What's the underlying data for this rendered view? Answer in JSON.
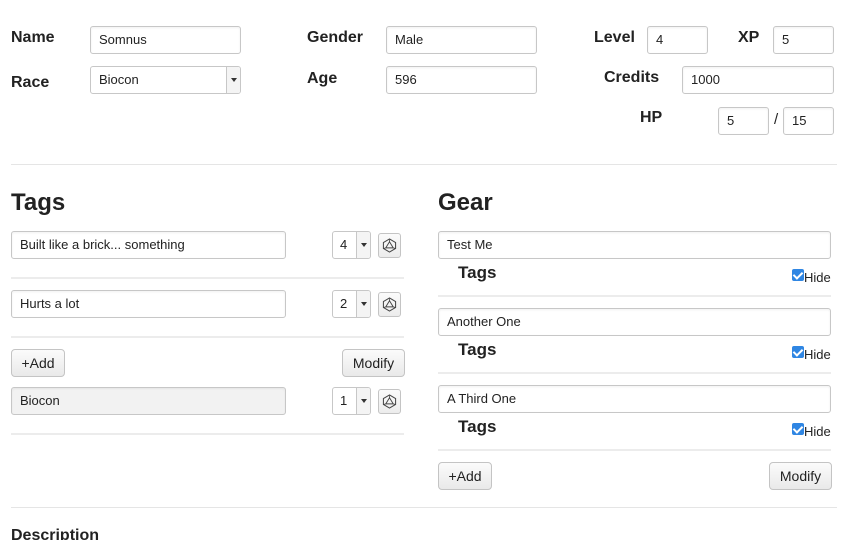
{
  "character": {
    "name_label": "Name",
    "name_value": "Somnus",
    "race_label": "Race",
    "race_value": "Biocon",
    "gender_label": "Gender",
    "gender_value": "Male",
    "age_label": "Age",
    "age_value": "596",
    "level_label": "Level",
    "level_value": "4",
    "xp_label": "XP",
    "xp_value": "5",
    "credits_label": "Credits",
    "credits_value": "1000",
    "hp_label": "HP",
    "hp_current": "5",
    "hp_separator": "/",
    "hp_max": "15"
  },
  "tags": {
    "title": "Tags",
    "items": [
      {
        "text": "Built like a brick... something",
        "level": "4"
      },
      {
        "text": "Hurts a lot",
        "level": "2"
      }
    ],
    "add_label": "+Add",
    "modify_label": "Modify",
    "race_tag": {
      "text": "Biocon",
      "level": "1"
    }
  },
  "gear": {
    "title": "Gear",
    "items": [
      {
        "name": "Test Me",
        "tags_label": "Tags",
        "hide_label": "Hide",
        "hidden": true
      },
      {
        "name": "Another One",
        "tags_label": "Tags",
        "hide_label": "Hide",
        "hidden": true
      },
      {
        "name": "A Third One",
        "tags_label": "Tags",
        "hide_label": "Hide",
        "hidden": true
      }
    ],
    "add_label": "+Add",
    "modify_label": "Modify"
  },
  "description": {
    "title": "Description"
  },
  "icons": {
    "die": "d20-die-icon",
    "checkbox": "checkbox-checked-icon",
    "caret": "chevron-down-icon"
  },
  "colors": {
    "checkbox_accent": "#2f86e3",
    "divider": "#e5e5e5"
  }
}
